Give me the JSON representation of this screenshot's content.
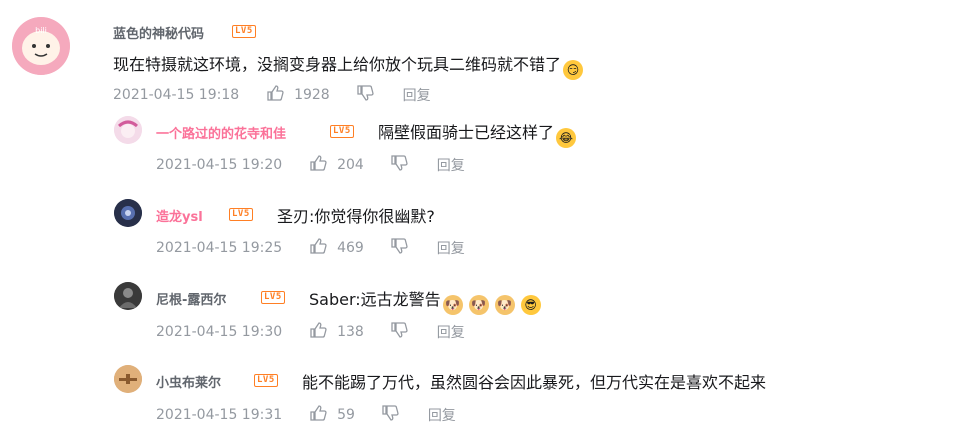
{
  "accent": {
    "badge": "#ff7f24",
    "pink_name": "#fb7299",
    "name": "#61666d",
    "meta": "#9499a0"
  },
  "comments": [
    {
      "user": "蓝色的神秘代码",
      "level": "LV5",
      "text": "现在特摄就这环境，没搁变身器上给你放个玩具二维码就不错了",
      "emoji": "smirk-emoji",
      "time": "2021-04-15 19:18",
      "likes": "1928",
      "reply": "回复"
    },
    {
      "user": "一个路过的的花寺和佳",
      "level": "LV5",
      "text": "隔壁假面骑士已经这样了",
      "emoji": "laugh-cry-emoji",
      "time": "2021-04-15 19:20",
      "likes": "204",
      "reply": "回复"
    },
    {
      "user": "造龙ysl",
      "level": "LV5",
      "text": "圣刃:你觉得你很幽默?",
      "time": "2021-04-15 19:25",
      "likes": "469",
      "reply": "回复"
    },
    {
      "user": "尼根-露西尔",
      "level": "LV5",
      "text": "Saber:远古龙警告",
      "emoji": "doge-emoji",
      "time": "2021-04-15 19:30",
      "likes": "138",
      "reply": "回复"
    },
    {
      "user": "小虫布莱尔",
      "level": "LV5",
      "text": "能不能踢了万代，虽然圆谷会因此暴死，但万代实在是喜欢不起来",
      "time": "2021-04-15 19:31",
      "likes": "59",
      "reply": "回复"
    }
  ]
}
